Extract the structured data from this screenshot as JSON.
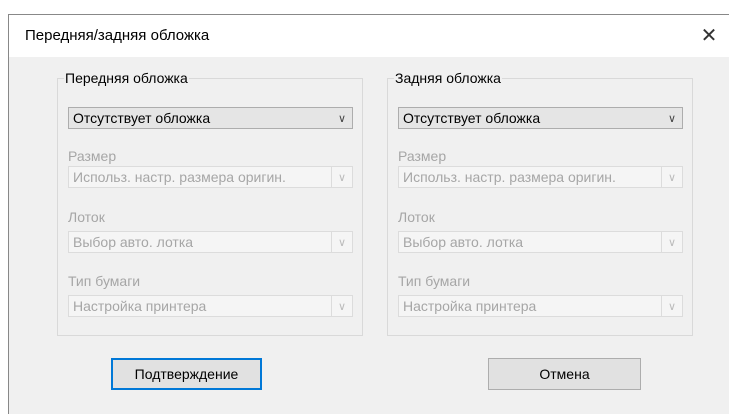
{
  "window": {
    "title": "Передняя/задняя обложка",
    "close_symbol": "✕"
  },
  "front": {
    "group_label": "Передняя обложка",
    "cover_value": "Отсутствует обложка",
    "size_label": "Размер",
    "size_value": "Использ. настр. размера оригин.",
    "tray_label": "Лоток",
    "tray_value": "Выбор авто. лотка",
    "paper_label": "Тип бумаги",
    "paper_value": "Настройка принтера"
  },
  "back": {
    "group_label": "Задняя обложка",
    "cover_value": "Отсутствует обложка",
    "size_label": "Размер",
    "size_value": "Использ. настр. размера оригин.",
    "tray_label": "Лоток",
    "tray_value": "Выбор авто. лотка",
    "paper_label": "Тип бумаги",
    "paper_value": "Настройка принтера"
  },
  "buttons": {
    "confirm_label": "Подтверждение",
    "cancel_label": "Отмена"
  },
  "icons": {
    "chevron": "﹀"
  }
}
